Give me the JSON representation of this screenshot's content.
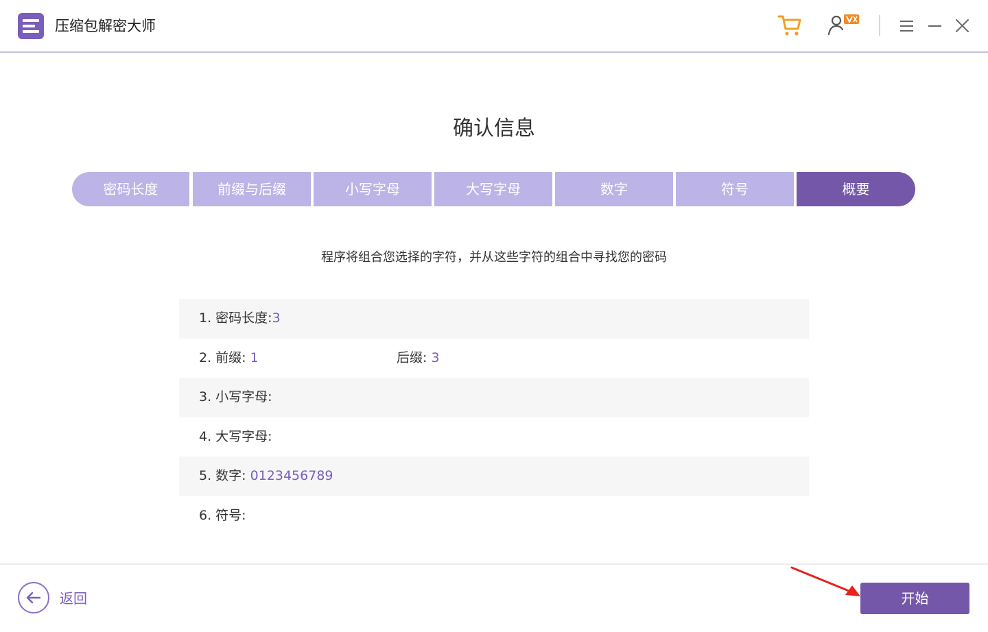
{
  "app": {
    "title": "压缩包解密大师"
  },
  "page": {
    "title": "确认信息",
    "description": "程序将组合您选择的字符，并从这些字符的组合中寻找您的密码"
  },
  "steps": [
    {
      "label": "密码长度"
    },
    {
      "label": "前缀与后缀"
    },
    {
      "label": "小写字母"
    },
    {
      "label": "大写字母"
    },
    {
      "label": "数字"
    },
    {
      "label": "符号"
    },
    {
      "label": "概要",
      "active": true
    }
  ],
  "summary": {
    "length": {
      "label": "1. 密码长度:",
      "value": "3"
    },
    "prefix": {
      "label": "2. 前缀: ",
      "value": "1"
    },
    "suffix": {
      "label": "后缀: ",
      "value": "3"
    },
    "lowercase": {
      "label": "3. 小写字母:",
      "value": ""
    },
    "uppercase": {
      "label": "4. 大写字母:",
      "value": ""
    },
    "digits": {
      "label": "5. 数字: ",
      "value": "0123456789"
    },
    "symbols": {
      "label": "6. 符号:",
      "value": ""
    }
  },
  "footer": {
    "back_label": "返回",
    "start_label": "开始"
  },
  "colors": {
    "accent": "#7457a8",
    "step_inactive": "#bcb3e6",
    "value_text": "#7a5ebd",
    "cart_icon": "#f0a020",
    "annotation_arrow": "#e8201e"
  },
  "icons": [
    "app-logo-icon",
    "cart-icon",
    "user-vip-icon",
    "menu-icon",
    "minimize-icon",
    "close-icon",
    "back-arrow-icon"
  ]
}
